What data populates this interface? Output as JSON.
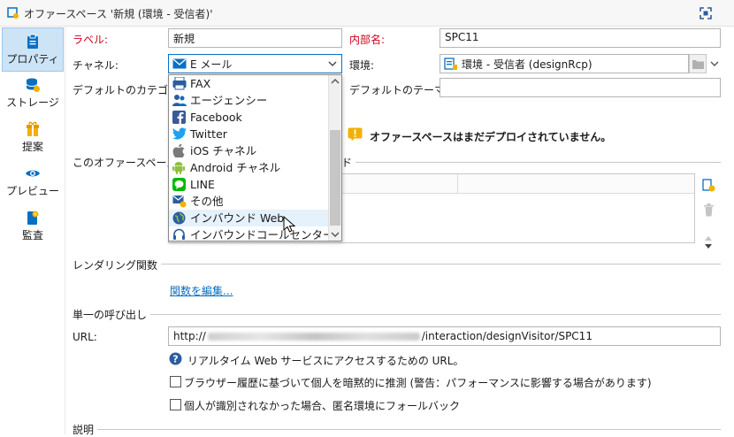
{
  "window": {
    "title": "オファースペース '新規 (環境 - 受信者)'"
  },
  "sidebar": {
    "items": [
      {
        "label": "プロパティ",
        "icon": "properties-icon",
        "active": true
      },
      {
        "label": "ストレージ",
        "icon": "storage-icon"
      },
      {
        "label": "提案",
        "icon": "proposition-icon"
      },
      {
        "label": "プレビュー",
        "icon": "preview-icon"
      },
      {
        "label": "監査",
        "icon": "audit-icon"
      }
    ]
  },
  "form": {
    "label_label": "ラベル:",
    "label_value": "新規",
    "internal_name_label": "内部名:",
    "internal_name_value": "SPC11",
    "channel_label": "チャネル:",
    "channel_value": "E メール",
    "environment_label": "環境:",
    "environment_value": "環境 - 受信者 (designRcp)",
    "default_category_label": "デフォルトのカテゴリ:",
    "default_theme_label": "デフォルトのテーマ:",
    "warning_text": "オファースペースはまだデプロイされていません。",
    "offerspace_section_label": "このオファースペースに",
    "offerspace_section_tail": "ド"
  },
  "channel_dropdown": {
    "options": [
      {
        "label": "FAX",
        "icon": "fax-icon"
      },
      {
        "label": "エージェンシー",
        "icon": "agency-icon"
      },
      {
        "label": "Facebook",
        "icon": "facebook-icon"
      },
      {
        "label": "Twitter",
        "icon": "twitter-icon"
      },
      {
        "label": "iOS チャネル",
        "icon": "apple-icon"
      },
      {
        "label": "Android チャネル",
        "icon": "android-icon"
      },
      {
        "label": "LINE",
        "icon": "line-icon"
      },
      {
        "label": "その他",
        "icon": "other-icon"
      },
      {
        "label": "インバウンド Web",
        "icon": "globe-icon",
        "hover": true
      },
      {
        "label": "インバウンドコールセンター",
        "icon": "headset-icon"
      }
    ]
  },
  "rendering": {
    "section_title": "レンダリング関数",
    "edit_link": "関数を編集..."
  },
  "single_call": {
    "section_title": "単一の呼び出し",
    "url_label": "URL:",
    "url_prefix": "http://",
    "url_suffix": "/interaction/designVisitor/SPC11",
    "help_text": "リアルタイム Web サービスにアクセスするための URL。",
    "checkbox1_label": "ブラウザー履歴に基づいて個人を暗黙的に推測 (警告：パフォーマンスに影響する場合があります)",
    "checkbox2_label": "個人が識別されなかった場合、匿名環境にフォールバック"
  },
  "description": {
    "section_title": "説明"
  },
  "colors": {
    "accent": "#0a6fc2",
    "warning": "#f2b100",
    "sidebar_active": "#cde4f7",
    "required": "#d0021b"
  }
}
